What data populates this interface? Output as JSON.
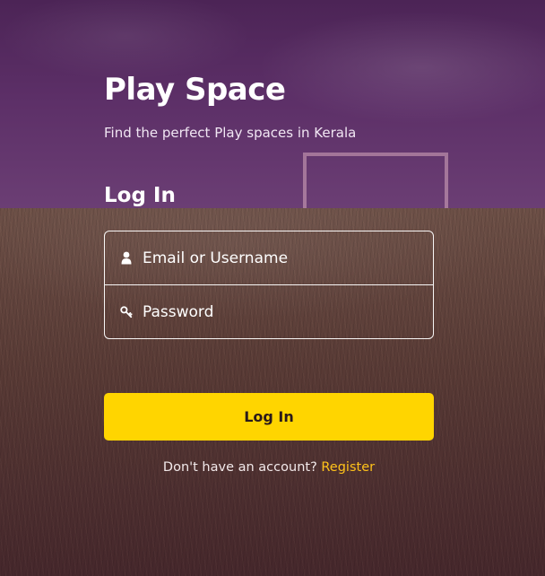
{
  "app": {
    "title": "Play Space",
    "subtitle": "Find the perfect Play spaces in Kerala"
  },
  "login": {
    "heading": "Log In",
    "username": {
      "placeholder": "Email or Username",
      "value": "",
      "icon": "user-icon"
    },
    "password": {
      "placeholder": "Password",
      "value": "",
      "icon": "key-icon"
    },
    "submit_label": "Log In"
  },
  "footer": {
    "prompt": "Don't have an account?",
    "register_label": "Register"
  },
  "colors": {
    "accent": "#ffd500",
    "link": "#ffc21a",
    "sky": "#5c2f67",
    "grass": "#5e4038"
  }
}
